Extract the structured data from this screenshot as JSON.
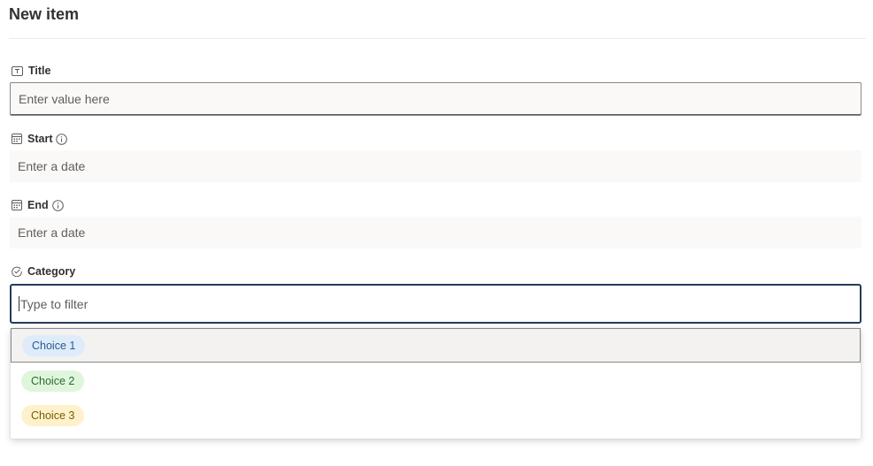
{
  "header": {
    "title": "New item"
  },
  "fields": {
    "title": {
      "label": "Title",
      "placeholder": "Enter value here",
      "icon": "text-field-icon"
    },
    "start": {
      "label": "Start",
      "placeholder": "Enter a date",
      "icon": "calendar-icon"
    },
    "end": {
      "label": "End",
      "placeholder": "Enter a date",
      "icon": "calendar-icon"
    },
    "category": {
      "label": "Category",
      "placeholder": "Type to filter",
      "icon": "choice-check-icon"
    }
  },
  "dropdown": {
    "options": [
      {
        "label": "Choice 1",
        "bg": "#deecf9",
        "fg": "#2b5a91",
        "selected": true
      },
      {
        "label": "Choice 2",
        "bg": "#dff6dd",
        "fg": "#2f6a2c",
        "selected": false
      },
      {
        "label": "Choice 3",
        "bg": "#fff1cc",
        "fg": "#7a5b00",
        "selected": false
      }
    ]
  },
  "colors": {
    "focus_border": "#243a5e",
    "input_bg": "#faf9f8"
  }
}
